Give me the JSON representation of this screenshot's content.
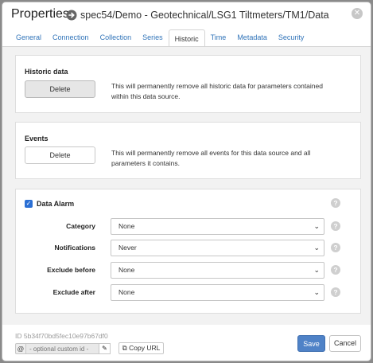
{
  "dialog": {
    "title": "Properties",
    "path": "spec54/Demo - Geotechnical/LSG1 Tiltmeters/TM1/Data",
    "close_icon": "close-icon"
  },
  "tabs": [
    {
      "label": "General"
    },
    {
      "label": "Connection"
    },
    {
      "label": "Collection"
    },
    {
      "label": "Series"
    },
    {
      "label": "Historic",
      "active": true
    },
    {
      "label": "Time"
    },
    {
      "label": "Metadata"
    },
    {
      "label": "Security"
    }
  ],
  "historic_panel": {
    "title": "Historic data",
    "button_label": "Delete",
    "description": "This will permanently remove all historic data for parameters contained within this data source."
  },
  "events_panel": {
    "title": "Events",
    "button_label": "Delete",
    "description": "This will permanently remove all events for this data source and all parameters it contains."
  },
  "alarm_panel": {
    "checkbox_label": "Data Alarm",
    "checked": true,
    "fields": [
      {
        "label": "Category",
        "value": "None"
      },
      {
        "label": "Notifications",
        "value": "Never"
      },
      {
        "label": "Exclude before",
        "value": "None"
      },
      {
        "label": "Exclude after",
        "value": "None"
      }
    ],
    "help_symbol": "?"
  },
  "footer": {
    "id_text": "ID  5b34f70bd5fec10e97b67df0",
    "at_symbol": "@",
    "custom_id_placeholder": "- optional custom id -",
    "copy_url_label": "Copy URL",
    "save_label": "Save",
    "cancel_label": "Cancel"
  },
  "colors": {
    "accent": "#4f82c7",
    "tab_link": "#3174b9",
    "checkbox": "#2b6fd4"
  }
}
